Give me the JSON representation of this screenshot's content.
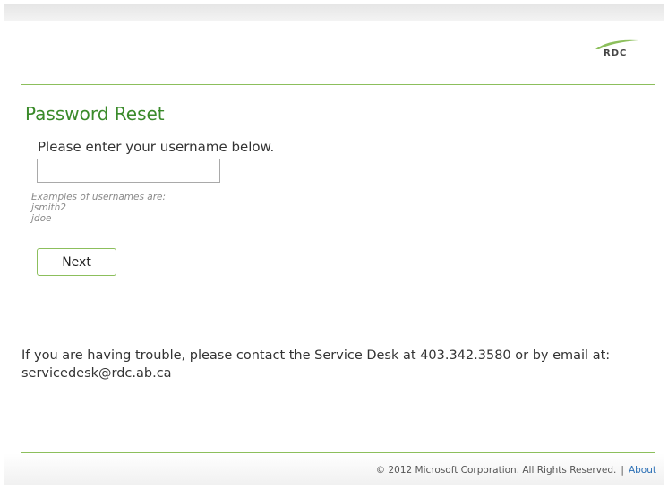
{
  "header": {
    "logo": {
      "text": "RDC",
      "icon": "rdc-logo-swoosh",
      "accent_color": "#8cbf5c"
    }
  },
  "main": {
    "title": "Password Reset",
    "instruction": "Please enter your username below.",
    "username_input": {
      "value": "",
      "placeholder": ""
    },
    "examples": [
      "Examples of usernames are:",
      "jsmith2",
      "jdoe"
    ],
    "next_label": "Next"
  },
  "help": {
    "text": "If you are having trouble, please contact the Service Desk at 403.342.3580 or by email at: servicedesk@rdc.ab.ca"
  },
  "footer": {
    "copyright": "© 2012 Microsoft Corporation. All Rights Reserved.",
    "separator": "|",
    "about_label": "About"
  },
  "colors": {
    "title": "#3a8a2a",
    "rule": "#8cbf5c",
    "link": "#2a6fb5"
  }
}
